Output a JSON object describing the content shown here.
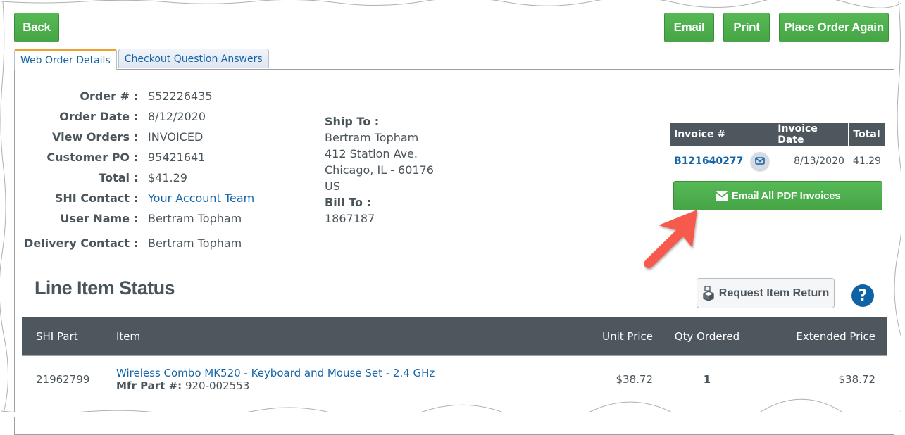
{
  "toolbar": {
    "back_label": "Back",
    "email_label": "Email",
    "print_label": "Print",
    "reorder_label": "Place Order Again"
  },
  "tabs": [
    {
      "label": "Web Order Details",
      "active": true
    },
    {
      "label": "Checkout Question Answers",
      "active": false
    }
  ],
  "order_info": {
    "order_no_label": "Order # :",
    "order_no": "S52226435",
    "order_date_label": "Order Date :",
    "order_date": "8/12/2020",
    "view_orders_label": "View Orders :",
    "view_orders": "INVOICED",
    "customer_po_label": "Customer PO :",
    "customer_po": "95421641",
    "total_label": "Total :",
    "total": "$41.29",
    "shi_contact_label": "SHI Contact :",
    "shi_contact": "Your Account Team",
    "user_name_label": "User Name :",
    "user_name": "Bertram Topham",
    "delivery_contact_label": "Delivery Contact :",
    "delivery_contact": "Bertram Topham"
  },
  "ship_to": {
    "label": "Ship To :",
    "name": "Bertram Topham",
    "street": "412 Station Ave.",
    "city": "Chicago, IL - 60176",
    "country": "US"
  },
  "bill_to": {
    "label": "Bill To :",
    "account": "1867187"
  },
  "invoices": {
    "headers": [
      "Invoice #",
      "Invoice Date",
      "Total"
    ],
    "rows": [
      {
        "number": "B121640277",
        "date": "8/13/2020",
        "total": "41.29"
      }
    ],
    "email_all_label": "Email All PDF Invoices"
  },
  "line_items": {
    "title": "Line Item Status",
    "return_label": "Request Item Return",
    "help_glyph": "?",
    "headers": [
      "SHI Part",
      "Item",
      "Unit Price",
      "Qty Ordered",
      "Extended Price"
    ],
    "rows": [
      {
        "shi_part": "21962799",
        "item": "Wireless Combo MK520 - Keyboard and Mouse Set - 2.4 GHz",
        "mfr_label": "Mfr Part #:",
        "mfr_part": "920-002553",
        "unit_price": "$38.72",
        "qty": "1",
        "extended_price": "$38.72"
      }
    ]
  },
  "colors": {
    "button_green": "#4cae4c",
    "header_dark": "#4d575d",
    "link_blue": "#1565a8",
    "tab_active_accent": "#f1a030",
    "annotation_arrow": "#f55a4e"
  }
}
